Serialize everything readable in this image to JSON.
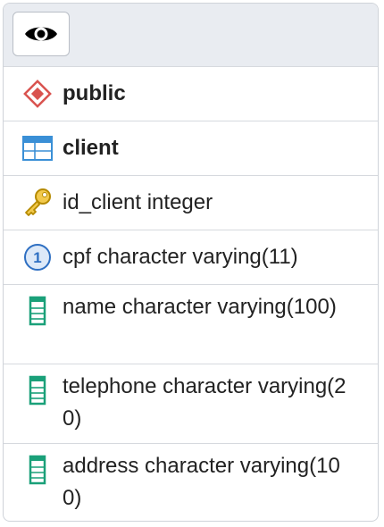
{
  "header": {
    "toggle_icon": "eye-icon"
  },
  "rows": [
    {
      "icon": "schema-icon",
      "text": "public",
      "bold": true
    },
    {
      "icon": "table-icon",
      "text": "client",
      "bold": true
    },
    {
      "icon": "primary-key-icon",
      "text": "id_client integer"
    },
    {
      "icon": "unique-index-icon",
      "icon_text": "1",
      "text": "cpf character varying(11)"
    },
    {
      "icon": "column-icon",
      "text": "name character varying(100)"
    },
    {
      "icon": "column-icon",
      "text": "telephone character varying(20)"
    },
    {
      "icon": "column-icon",
      "text": "address character varying(100)"
    }
  ],
  "colors": {
    "schema": "#d9534f",
    "table": "#3a8fd6",
    "key": "#e0b21a",
    "unique": "#2e6fc2",
    "column": "#1aa079"
  }
}
